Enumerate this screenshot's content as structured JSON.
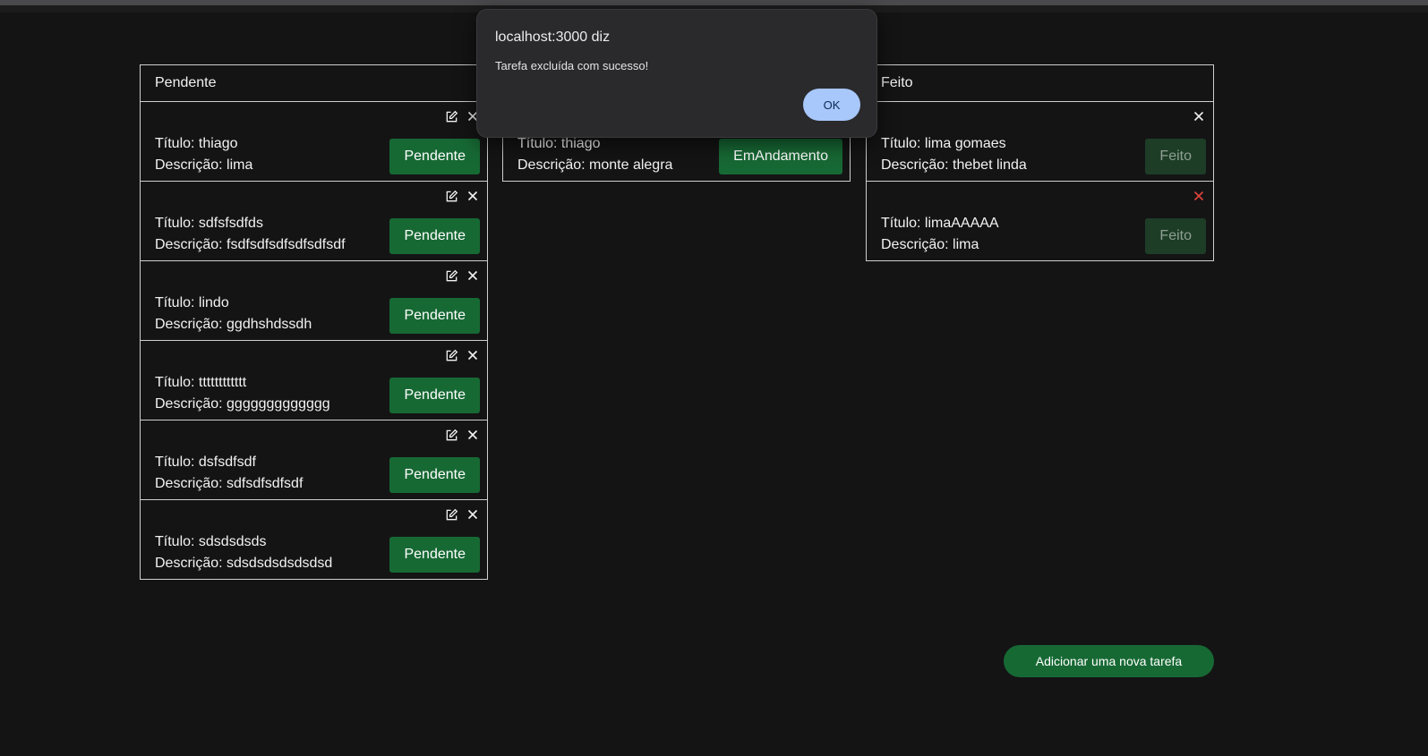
{
  "dialog": {
    "title": "localhost:3000 diz",
    "message": "Tarefa excluída com sucesso!",
    "ok_label": "OK"
  },
  "columns": {
    "pendente": {
      "title": "Pendente",
      "cards": [
        {
          "titulo": "Título: thiago",
          "descricao": "Descrição: lima",
          "status": "Pendente"
        },
        {
          "titulo": "Título: sdfsfsdfds",
          "descricao": "Descrição: fsdfsdfsdfsdfsdfsdf",
          "status": "Pendente"
        },
        {
          "titulo": "Título: lindo",
          "descricao": "Descrição: ggdhshdssdh",
          "status": "Pendente"
        },
        {
          "titulo": "Título: tttttttttttt",
          "descricao": "Descrição: ggggggggggggg",
          "status": "Pendente"
        },
        {
          "titulo": "Título: dsfsdfsdf",
          "descricao": "Descrição: sdfsdfsdfsdf",
          "status": "Pendente"
        },
        {
          "titulo": "Título: sdsdsdsds",
          "descricao": "Descrição: sdsdsdsdsdsdsd",
          "status": "Pendente"
        }
      ]
    },
    "andamento": {
      "cards": [
        {
          "titulo": "Título: thiago",
          "descricao": "Descrição: monte alegra",
          "status": "EmAndamento"
        }
      ]
    },
    "feito": {
      "title": "Feito",
      "cards": [
        {
          "titulo": "Título: lima gomaes",
          "descricao": "Descrição: thebet linda",
          "status": "Feito"
        },
        {
          "titulo": "Título: limaAAAAA",
          "descricao": "Descrição: lima",
          "status": "Feito"
        }
      ]
    }
  },
  "add_task_label": "Adicionar uma nova tarefa",
  "colors": {
    "background": "#141415",
    "status_green": "#176934",
    "status_done": "#1d3d27",
    "delete_red": "#e0433a",
    "dialog_ok": "#a8c7fa"
  },
  "icons": {
    "edit": "edit-icon",
    "delete": "close-icon"
  }
}
